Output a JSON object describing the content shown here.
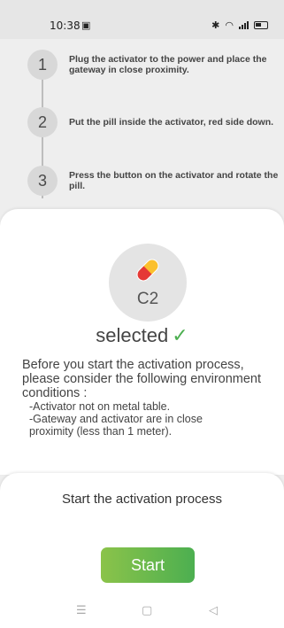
{
  "status_bar": {
    "time": "10:38",
    "app_icon": "teams-icon",
    "icons": [
      "bluetooth-icon",
      "wifi-icon",
      "signal-icon",
      "battery-icon"
    ]
  },
  "steps": [
    {
      "number": "1",
      "text": "Plug the activator to the power and place the gateway in close proximity."
    },
    {
      "number": "2",
      "text": "Put the pill inside the activator, red side down."
    },
    {
      "number": "3",
      "text": "Press the button on the activator and rotate the pill."
    }
  ],
  "pill": {
    "label": "C2",
    "status": "selected",
    "icon": "pill-icon",
    "colors": {
      "top": "#e53935",
      "bottom": "#fbc02d",
      "accent": "#4caf50"
    }
  },
  "info": {
    "intro": "Before you start the activation process, please consider the following environment conditions :",
    "bullets": [
      "-Activator not on metal table.",
      "-Gateway and activator are in close",
      "proximity (less than 1 meter)."
    ]
  },
  "activation": {
    "title": "Start the activation process",
    "button_label": "Start"
  },
  "nav": {
    "items": [
      "menu-icon",
      "home-icon",
      "back-icon"
    ]
  }
}
